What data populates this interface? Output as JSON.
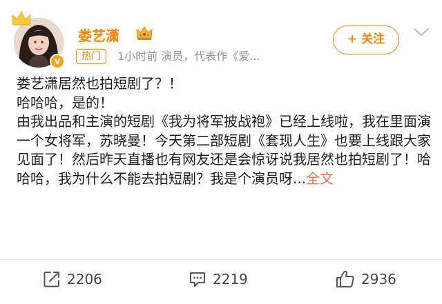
{
  "header": {
    "username": "娄艺潇",
    "hot_tag": "热门",
    "meta": "1小时前  演员，代表作《爱...",
    "follow_label": "+ 关注",
    "badge_letter": "v"
  },
  "post": {
    "lines": [
      "娄艺潇居然也拍短剧了？！",
      "哈哈哈，是的！",
      "由我出品和主演的短剧《我为将军披战袍》已经上线啦，我在里面演一个女将军，苏晓曼！今天第二部短剧《套现人生》也要上线跟大家见面了！然后昨天直播也有网友还是会惊讶说我居然也拍短剧了！哈哈哈，我为什么不能去拍短剧？我是个演员呀..."
    ],
    "more_label": "全文"
  },
  "footer": {
    "share_count": "2206",
    "comment_count": "2219",
    "like_count": "2936"
  },
  "colors": {
    "accent": "#ff8200",
    "more_link": "#eb7350",
    "text": "#1f1f1f",
    "meta": "#939393"
  },
  "icons": {
    "share": "share-icon",
    "comment": "comment-icon",
    "like": "thumbs-up-icon",
    "chevron": "chevron-down-icon",
    "vip": "vip-crown-icon"
  }
}
